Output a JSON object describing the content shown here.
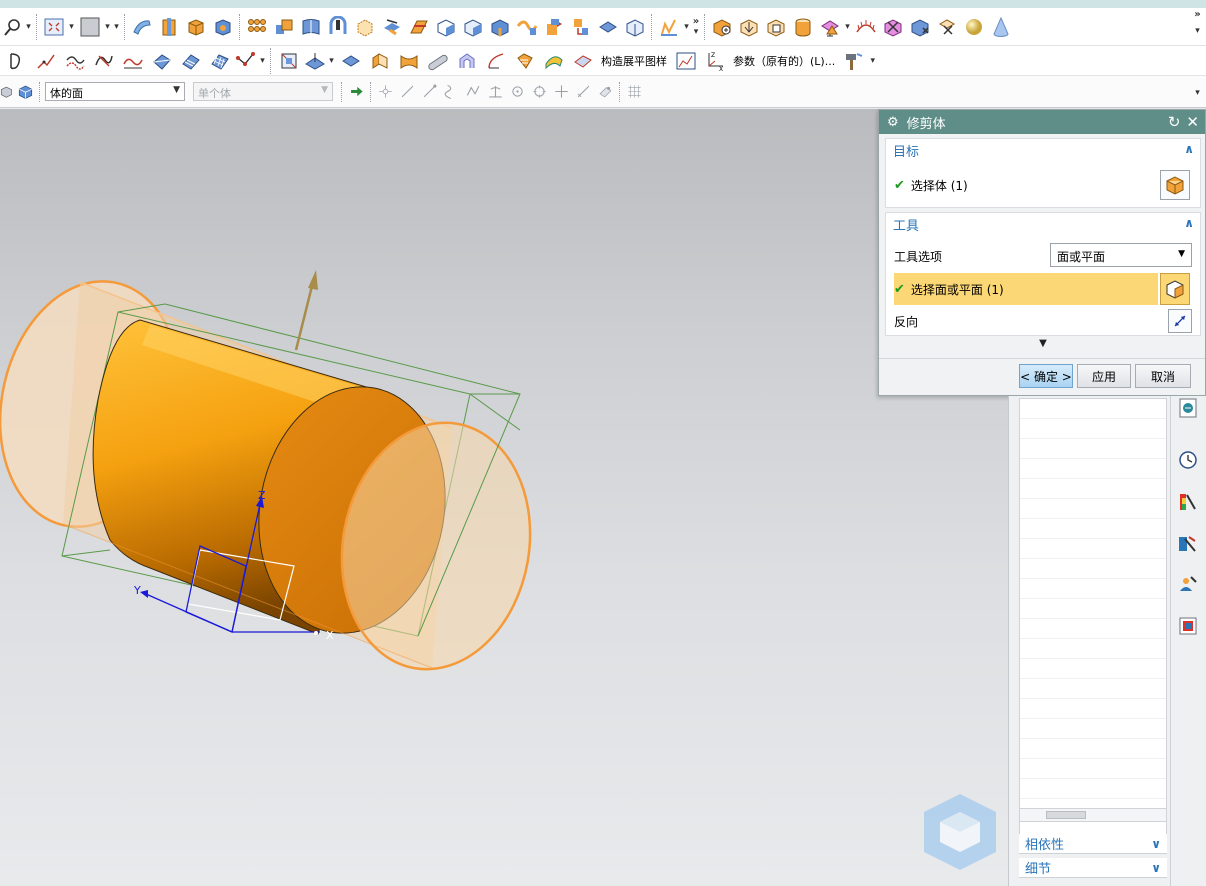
{
  "toolbar2": {
    "flat_pattern_label": "构造展平图样",
    "param_label": "参数（原有的）(L)..."
  },
  "selection_bar": {
    "filter_type": "体的面",
    "scope": "单个体"
  },
  "dialog": {
    "title": "修剪体",
    "target": {
      "header": "目标",
      "select_body_label": "选择体 (1)"
    },
    "tool": {
      "header": "工具",
      "option_label": "工具选项",
      "option_value": "面或平面",
      "select_face_label": "选择面或平面 (1)",
      "reverse_label": "反向"
    },
    "buttons": {
      "ok": "< 确定 >",
      "apply": "应用",
      "cancel": "取消"
    }
  },
  "navigator": {
    "dependencies": "相依性",
    "details": "细节"
  },
  "scene": {
    "axis_labels": {
      "x": "X",
      "y": "Y",
      "z": "Z"
    },
    "colors": {
      "body": "#f29a13",
      "transparent_body": "#f7d7a8",
      "edge": "#f59a3a",
      "bbox": "#5a9a4a",
      "axes": "#1a1ad8",
      "vector": "#a88c4a"
    }
  },
  "icons": {
    "toolbar1": [
      "zoom-icon",
      "fit-view-icon",
      "render-style-icon",
      "swept-icon",
      "extrude-icon",
      "block-icon",
      "hole-icon",
      "pattern-icon",
      "union-icon",
      "sheet-icon",
      "thread-icon",
      "trim-body-icon",
      "split-icon",
      "offset-icon",
      "draft-icon",
      "blend-icon",
      "shell-icon",
      "chamfer-icon",
      "move-face-icon",
      "emboss-icon",
      "replace-face-icon",
      "boolean-icon",
      "sphere-icon",
      "cone-icon"
    ],
    "toolbar2": [
      "sketch-curve-icon",
      "fillet-curve-icon",
      "offset-curve-icon",
      "trim-curve-icon",
      "bridge-curve-icon",
      "through-curves-icon",
      "ruled-icon",
      "mesh-surface-icon",
      "connector-icon",
      "section-icon",
      "face-offset-icon",
      "wave-surface-icon",
      "fold-face-icon",
      "bend-icon",
      "tube-icon",
      "rib-icon",
      "extend-icon",
      "surface-icon",
      "wave-icon",
      "law-icon",
      "flat-pattern-icon",
      "chart-icon",
      "wcs-icon",
      "hammer-icon"
    ]
  }
}
